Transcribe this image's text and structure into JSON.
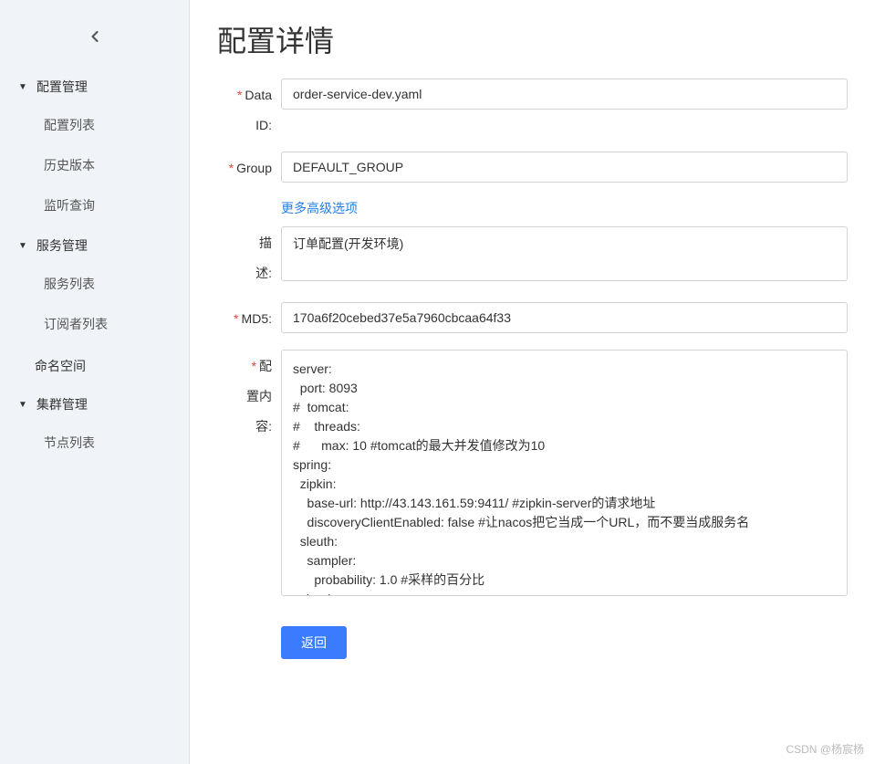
{
  "sidebar": {
    "groups": [
      {
        "label": "配置管理",
        "items": [
          "配置列表",
          "历史版本",
          "监听查询"
        ]
      },
      {
        "label": "服务管理",
        "items": [
          "服务列表",
          "订阅者列表"
        ]
      }
    ],
    "namespace_label": "命名空间",
    "cluster": {
      "label": "集群管理",
      "items": [
        "节点列表"
      ]
    }
  },
  "page": {
    "title": "配置详情",
    "advanced_link": "更多高级选项",
    "back_button": "返回"
  },
  "form": {
    "data_id": {
      "label1": "Data",
      "label2": "ID:",
      "value": "order-service-dev.yaml"
    },
    "group": {
      "label": "Group",
      "value": "DEFAULT_GROUP"
    },
    "description": {
      "label1": "描",
      "label2": "述:",
      "value": "订单配置(开发环境)"
    },
    "md5": {
      "label": "MD5:",
      "value": "170a6f20cebed37e5a7960cbcaa64f33"
    },
    "content": {
      "label1": "配",
      "label2": "置内",
      "label3": "容:",
      "value": "server:\n  port: 8093\n#  tomcat:\n#    threads:\n#      max: 10 #tomcat的最大并发值修改为10\nspring:\n  zipkin:\n    base-url: http://43.143.161.59:9411/ #zipkin-server的请求地址\n    discoveryClientEnabled: false #让nacos把它当成一个URL，而不要当成服务名\n  sleuth:\n    sampler:\n      probability: 1.0 #采样的百分比\n  cloud:\n    nacos:\n      discovery:"
    }
  },
  "watermark": "CSDN @杨宸杨"
}
